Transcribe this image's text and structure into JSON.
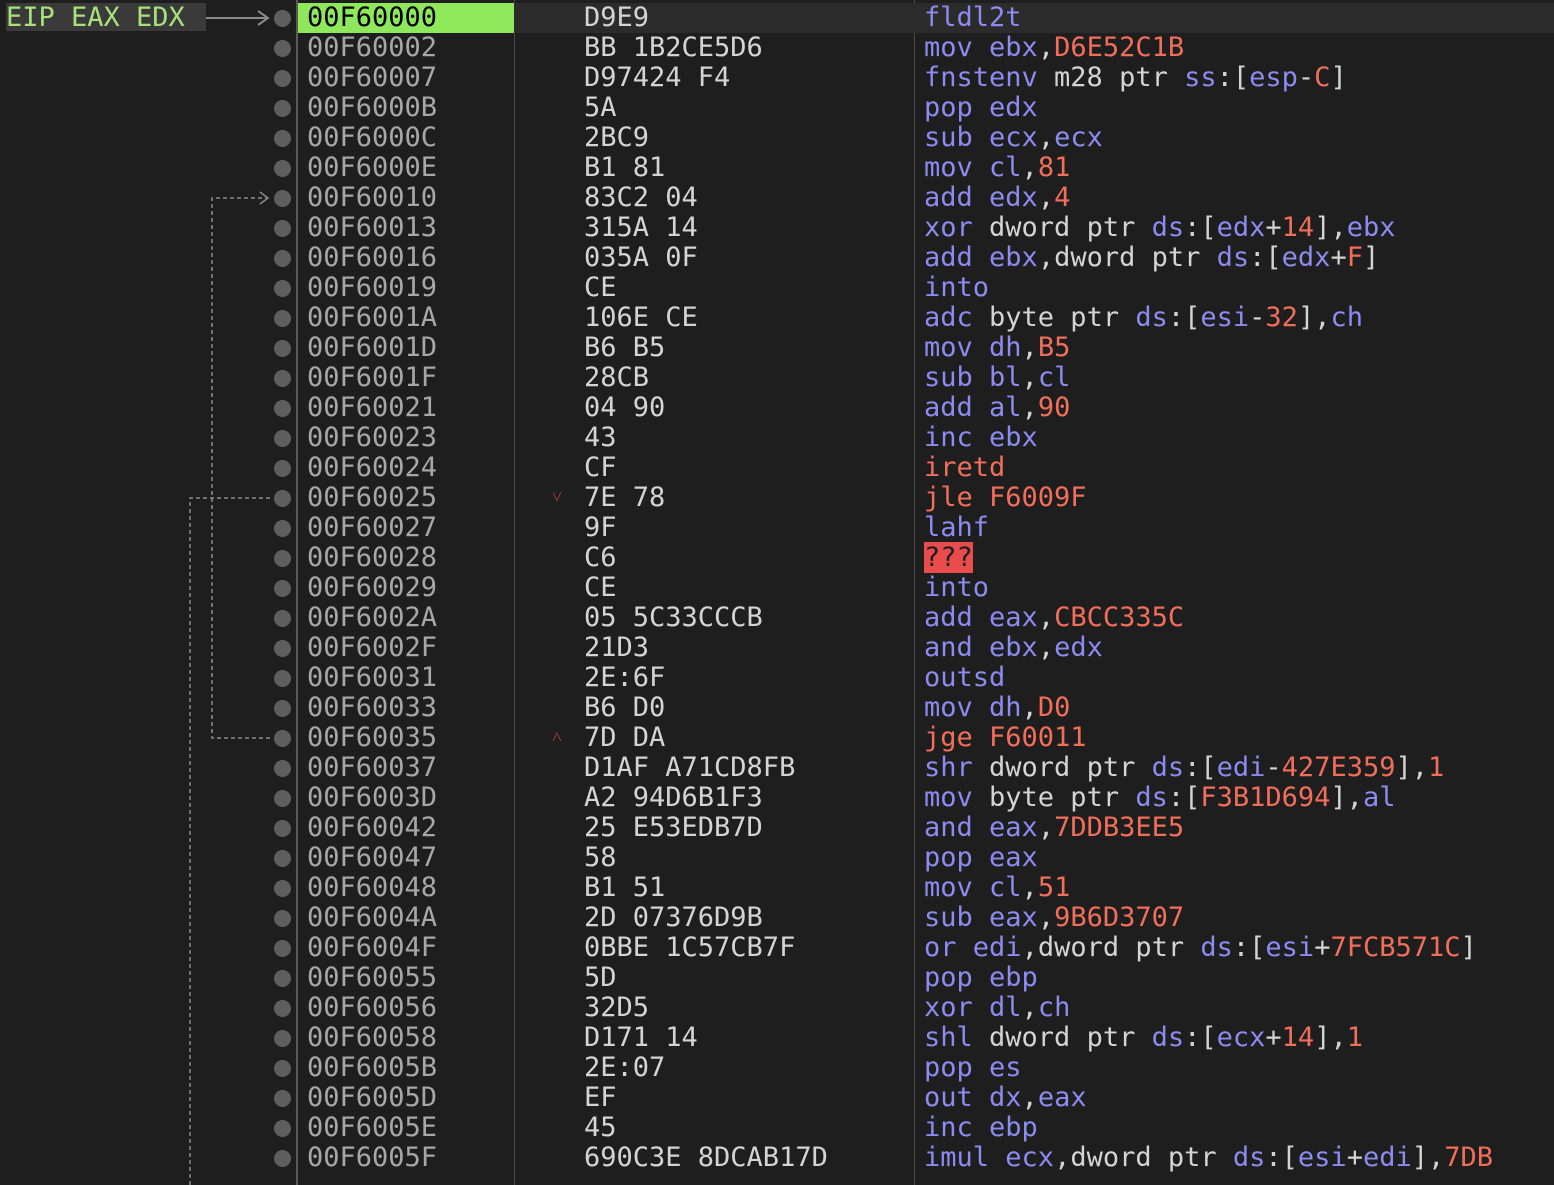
{
  "register_labels": "EIP EAX EDX",
  "colors": {
    "mnemonic": "#8b8bf0",
    "register": "#8b8bf0",
    "number": "#f06e5a",
    "text": "#d4d4d4",
    "address": "#a7a7a7",
    "jump": "#f06e5a",
    "current_address_bg": "#8ee85a",
    "unknown_bg": "#e84c4c"
  },
  "rows": [
    {
      "addr": "00F60000",
      "bytes": "D9E9",
      "mark": "",
      "tokens": [
        [
          "m",
          "fldl2t"
        ]
      ],
      "current": true
    },
    {
      "addr": "00F60002",
      "bytes": "BB 1B2CE5D6",
      "mark": "",
      "tokens": [
        [
          "m",
          "mov "
        ],
        [
          "r",
          "ebx"
        ],
        [
          "t",
          ","
        ],
        [
          "n",
          "D6E52C1B"
        ]
      ]
    },
    {
      "addr": "00F60007",
      "bytes": "D97424 F4",
      "mark": "",
      "tokens": [
        [
          "m",
          "fnstenv "
        ],
        [
          "t",
          "m28 ptr "
        ],
        [
          "r",
          "ss"
        ],
        [
          "t",
          ":["
        ],
        [
          "r",
          "esp"
        ],
        [
          "t",
          "-"
        ],
        [
          "n",
          "C"
        ],
        [
          "t",
          "]"
        ]
      ]
    },
    {
      "addr": "00F6000B",
      "bytes": "5A",
      "mark": "",
      "tokens": [
        [
          "m",
          "pop "
        ],
        [
          "r",
          "edx"
        ]
      ]
    },
    {
      "addr": "00F6000C",
      "bytes": "2BC9",
      "mark": "",
      "tokens": [
        [
          "m",
          "sub "
        ],
        [
          "r",
          "ecx"
        ],
        [
          "t",
          ","
        ],
        [
          "r",
          "ecx"
        ]
      ]
    },
    {
      "addr": "00F6000E",
      "bytes": "B1 81",
      "mark": "",
      "tokens": [
        [
          "m",
          "mov "
        ],
        [
          "r",
          "cl"
        ],
        [
          "t",
          ","
        ],
        [
          "n",
          "81"
        ]
      ]
    },
    {
      "addr": "00F60010",
      "bytes": "83C2 04",
      "mark": "",
      "tokens": [
        [
          "m",
          "add "
        ],
        [
          "r",
          "edx"
        ],
        [
          "t",
          ","
        ],
        [
          "n",
          "4"
        ]
      ]
    },
    {
      "addr": "00F60013",
      "bytes": "315A 14",
      "mark": "",
      "tokens": [
        [
          "m",
          "xor "
        ],
        [
          "t",
          "dword ptr "
        ],
        [
          "r",
          "ds"
        ],
        [
          "t",
          ":["
        ],
        [
          "r",
          "edx"
        ],
        [
          "t",
          "+"
        ],
        [
          "n",
          "14"
        ],
        [
          "t",
          "],"
        ],
        [
          "r",
          "ebx"
        ]
      ]
    },
    {
      "addr": "00F60016",
      "bytes": "035A 0F",
      "mark": "",
      "tokens": [
        [
          "m",
          "add "
        ],
        [
          "r",
          "ebx"
        ],
        [
          "t",
          ",dword ptr "
        ],
        [
          "r",
          "ds"
        ],
        [
          "t",
          ":["
        ],
        [
          "r",
          "edx"
        ],
        [
          "t",
          "+"
        ],
        [
          "n",
          "F"
        ],
        [
          "t",
          "]"
        ]
      ]
    },
    {
      "addr": "00F60019",
      "bytes": "CE",
      "mark": "",
      "tokens": [
        [
          "m",
          "into"
        ]
      ]
    },
    {
      "addr": "00F6001A",
      "bytes": "106E CE",
      "mark": "",
      "tokens": [
        [
          "m",
          "adc "
        ],
        [
          "t",
          "byte ptr "
        ],
        [
          "r",
          "ds"
        ],
        [
          "t",
          ":["
        ],
        [
          "r",
          "esi"
        ],
        [
          "t",
          "-"
        ],
        [
          "n",
          "32"
        ],
        [
          "t",
          "],"
        ],
        [
          "r",
          "ch"
        ]
      ]
    },
    {
      "addr": "00F6001D",
      "bytes": "B6 B5",
      "mark": "",
      "tokens": [
        [
          "m",
          "mov "
        ],
        [
          "r",
          "dh"
        ],
        [
          "t",
          ","
        ],
        [
          "n",
          "B5"
        ]
      ]
    },
    {
      "addr": "00F6001F",
      "bytes": "28CB",
      "mark": "",
      "tokens": [
        [
          "m",
          "sub "
        ],
        [
          "r",
          "bl"
        ],
        [
          "t",
          ","
        ],
        [
          "r",
          "cl"
        ]
      ]
    },
    {
      "addr": "00F60021",
      "bytes": "04 90",
      "mark": "",
      "tokens": [
        [
          "m",
          "add "
        ],
        [
          "r",
          "al"
        ],
        [
          "t",
          ","
        ],
        [
          "n",
          "90"
        ]
      ]
    },
    {
      "addr": "00F60023",
      "bytes": "43",
      "mark": "",
      "tokens": [
        [
          "m",
          "inc "
        ],
        [
          "r",
          "ebx"
        ]
      ]
    },
    {
      "addr": "00F60024",
      "bytes": "CF",
      "mark": "",
      "tokens": [
        [
          "j",
          "iretd"
        ]
      ]
    },
    {
      "addr": "00F60025",
      "bytes": "7E 78",
      "mark": "˅",
      "tokens": [
        [
          "j",
          "jle F6009F"
        ]
      ]
    },
    {
      "addr": "00F60027",
      "bytes": "9F",
      "mark": "",
      "tokens": [
        [
          "m",
          "lahf"
        ]
      ]
    },
    {
      "addr": "00F60028",
      "bytes": "C6",
      "mark": "",
      "tokens": [
        [
          "q",
          "???"
        ]
      ]
    },
    {
      "addr": "00F60029",
      "bytes": "CE",
      "mark": "",
      "tokens": [
        [
          "m",
          "into"
        ]
      ]
    },
    {
      "addr": "00F6002A",
      "bytes": "05 5C33CCCB",
      "mark": "",
      "tokens": [
        [
          "m",
          "add "
        ],
        [
          "r",
          "eax"
        ],
        [
          "t",
          ","
        ],
        [
          "n",
          "CBCC335C"
        ]
      ]
    },
    {
      "addr": "00F6002F",
      "bytes": "21D3",
      "mark": "",
      "tokens": [
        [
          "m",
          "and "
        ],
        [
          "r",
          "ebx"
        ],
        [
          "t",
          ","
        ],
        [
          "r",
          "edx"
        ]
      ]
    },
    {
      "addr": "00F60031",
      "bytes": "2E:6F",
      "mark": "",
      "tokens": [
        [
          "m",
          "outsd"
        ]
      ]
    },
    {
      "addr": "00F60033",
      "bytes": "B6 D0",
      "mark": "",
      "tokens": [
        [
          "m",
          "mov "
        ],
        [
          "r",
          "dh"
        ],
        [
          "t",
          ","
        ],
        [
          "n",
          "D0"
        ]
      ]
    },
    {
      "addr": "00F60035",
      "bytes": "7D DA",
      "mark": "˄",
      "tokens": [
        [
          "j",
          "jge F60011"
        ]
      ]
    },
    {
      "addr": "00F60037",
      "bytes": "D1AF A71CD8FB",
      "mark": "",
      "tokens": [
        [
          "m",
          "shr "
        ],
        [
          "t",
          "dword ptr "
        ],
        [
          "r",
          "ds"
        ],
        [
          "t",
          ":["
        ],
        [
          "r",
          "edi"
        ],
        [
          "t",
          "-"
        ],
        [
          "n",
          "427E359"
        ],
        [
          "t",
          "],"
        ],
        [
          "n",
          "1"
        ]
      ]
    },
    {
      "addr": "00F6003D",
      "bytes": "A2 94D6B1F3",
      "mark": "",
      "tokens": [
        [
          "m",
          "mov "
        ],
        [
          "t",
          "byte ptr "
        ],
        [
          "r",
          "ds"
        ],
        [
          "t",
          ":["
        ],
        [
          "n",
          "F3B1D694"
        ],
        [
          "t",
          "],"
        ],
        [
          "r",
          "al"
        ]
      ]
    },
    {
      "addr": "00F60042",
      "bytes": "25 E53EDB7D",
      "mark": "",
      "tokens": [
        [
          "m",
          "and "
        ],
        [
          "r",
          "eax"
        ],
        [
          "t",
          ","
        ],
        [
          "n",
          "7DDB3EE5"
        ]
      ]
    },
    {
      "addr": "00F60047",
      "bytes": "58",
      "mark": "",
      "tokens": [
        [
          "m",
          "pop "
        ],
        [
          "r",
          "eax"
        ]
      ]
    },
    {
      "addr": "00F60048",
      "bytes": "B1 51",
      "mark": "",
      "tokens": [
        [
          "m",
          "mov "
        ],
        [
          "r",
          "cl"
        ],
        [
          "t",
          ","
        ],
        [
          "n",
          "51"
        ]
      ]
    },
    {
      "addr": "00F6004A",
      "bytes": "2D 07376D9B",
      "mark": "",
      "tokens": [
        [
          "m",
          "sub "
        ],
        [
          "r",
          "eax"
        ],
        [
          "t",
          ","
        ],
        [
          "n",
          "9B6D3707"
        ]
      ]
    },
    {
      "addr": "00F6004F",
      "bytes": "0BBE 1C57CB7F",
      "mark": "",
      "tokens": [
        [
          "m",
          "or "
        ],
        [
          "r",
          "edi"
        ],
        [
          "t",
          ",dword ptr "
        ],
        [
          "r",
          "ds"
        ],
        [
          "t",
          ":["
        ],
        [
          "r",
          "esi"
        ],
        [
          "t",
          "+"
        ],
        [
          "n",
          "7FCB571C"
        ],
        [
          "t",
          "]"
        ]
      ]
    },
    {
      "addr": "00F60055",
      "bytes": "5D",
      "mark": "",
      "tokens": [
        [
          "m",
          "pop "
        ],
        [
          "r",
          "ebp"
        ]
      ]
    },
    {
      "addr": "00F60056",
      "bytes": "32D5",
      "mark": "",
      "tokens": [
        [
          "m",
          "xor "
        ],
        [
          "r",
          "dl"
        ],
        [
          "t",
          ","
        ],
        [
          "r",
          "ch"
        ]
      ]
    },
    {
      "addr": "00F60058",
      "bytes": "D171 14",
      "mark": "",
      "tokens": [
        [
          "m",
          "shl "
        ],
        [
          "t",
          "dword ptr "
        ],
        [
          "r",
          "ds"
        ],
        [
          "t",
          ":["
        ],
        [
          "r",
          "ecx"
        ],
        [
          "t",
          "+"
        ],
        [
          "n",
          "14"
        ],
        [
          "t",
          "],"
        ],
        [
          "n",
          "1"
        ]
      ]
    },
    {
      "addr": "00F6005B",
      "bytes": "2E:07",
      "mark": "",
      "tokens": [
        [
          "m",
          "pop "
        ],
        [
          "r",
          "es"
        ]
      ]
    },
    {
      "addr": "00F6005D",
      "bytes": "EF",
      "mark": "",
      "tokens": [
        [
          "m",
          "out "
        ],
        [
          "r",
          "dx"
        ],
        [
          "t",
          ","
        ],
        [
          "r",
          "eax"
        ]
      ]
    },
    {
      "addr": "00F6005E",
      "bytes": "45",
      "mark": "",
      "tokens": [
        [
          "m",
          "inc "
        ],
        [
          "r",
          "ebp"
        ]
      ]
    },
    {
      "addr": "00F6005F",
      "bytes": "690C3E 8DCAB17D",
      "mark": "",
      "tokens": [
        [
          "m",
          "imul "
        ],
        [
          "r",
          "ecx"
        ],
        [
          "t",
          ",dword ptr "
        ],
        [
          "r",
          "ds"
        ],
        [
          "t",
          ":["
        ],
        [
          "r",
          "esi"
        ],
        [
          "t",
          "+"
        ],
        [
          "r",
          "edi"
        ],
        [
          "t",
          "],"
        ],
        [
          "n",
          "7DB"
        ]
      ]
    }
  ]
}
